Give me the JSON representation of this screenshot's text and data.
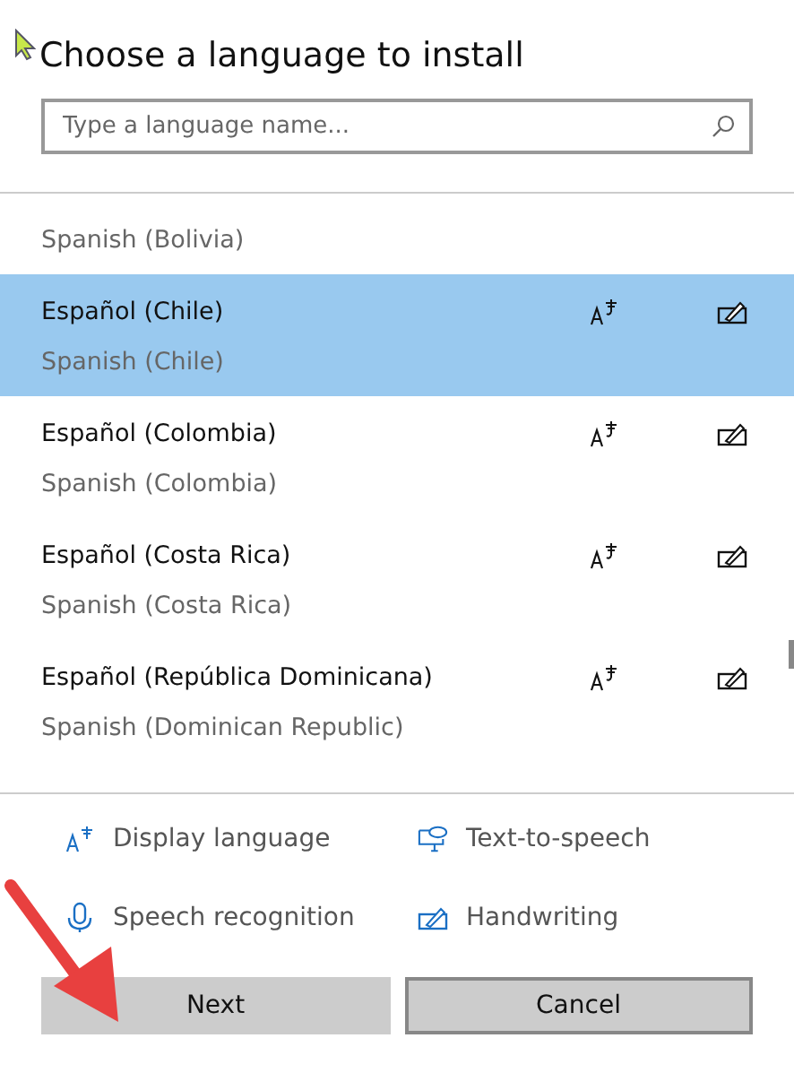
{
  "title": "Choose a language to install",
  "search": {
    "placeholder": "Type a language name..."
  },
  "languages": [
    {
      "subtitle": "Spanish (Bolivia)",
      "selected": false,
      "kind": "cut"
    },
    {
      "name": "Español (Chile)",
      "subtitle": "Spanish (Chile)",
      "selected": true
    },
    {
      "name": "Español (Colombia)",
      "subtitle": "Spanish (Colombia)",
      "selected": false
    },
    {
      "name": "Español (Costa Rica)",
      "subtitle": "Spanish (Costa Rica)",
      "selected": false
    },
    {
      "name": "Español (República Dominicana)",
      "subtitle": "Spanish (Dominican Republic)",
      "selected": false
    }
  ],
  "features": [
    {
      "kind": "display",
      "label": "Display language"
    },
    {
      "kind": "tts",
      "label": "Text-to-speech"
    },
    {
      "kind": "speech",
      "label": "Speech recognition"
    },
    {
      "kind": "handwriting",
      "label": "Handwriting"
    }
  ],
  "buttons": [
    {
      "label": "Next",
      "kind": "primary"
    },
    {
      "label": "Cancel",
      "kind": "secondary"
    }
  ]
}
